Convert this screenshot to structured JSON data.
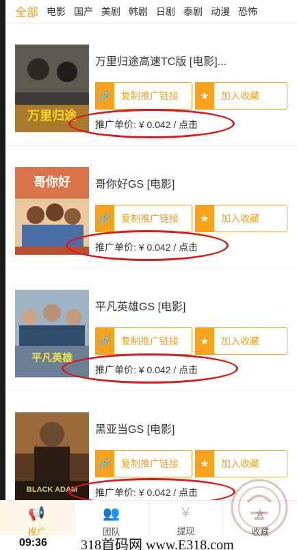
{
  "categories": [
    "全部",
    "电影",
    "国产",
    "美剧",
    "韩剧",
    "日剧",
    "泰剧",
    "动漫",
    "恐怖"
  ],
  "items": [
    {
      "title": "万里归途高速TC版 [电影]...",
      "copy_label": "复制推广链接",
      "fav_label": "加入收藏",
      "price": "推广单价: ¥ 0.042 / 点击",
      "poster_text": "万里归途",
      "poster_color": "#3b3a36"
    },
    {
      "title": "哥你好GS [电影]",
      "copy_label": "复制推广链接",
      "fav_label": "加入收藏",
      "price": "推广单价: ¥ 0.042 / 点击",
      "poster_text": "哥你好",
      "poster_color": "#b8502e"
    },
    {
      "title": "平凡英雄GS [电影]",
      "copy_label": "复制推广链接",
      "fav_label": "加入收藏",
      "price": "推广单价: ¥ 0.042 / 点击",
      "poster_text": "平凡英雄",
      "poster_color": "#6a7f95"
    },
    {
      "title": "黑亚当GS [电影]",
      "copy_label": "复制推广链接",
      "fav_label": "加入收藏",
      "price": "推广单价: ¥ 0.042 / 点击",
      "poster_text": "BLACK ADAM",
      "poster_color": "#5a3a22"
    }
  ],
  "tabs": [
    {
      "label": "推广",
      "icon": "megaphone-icon"
    },
    {
      "label": "团队",
      "icon": "team-icon"
    },
    {
      "label": "提现",
      "icon": "withdraw-icon"
    },
    {
      "label": "收藏",
      "icon": "favorites-icon"
    }
  ],
  "status_time": "09:36",
  "watermark": "318首码网 www.E318.com",
  "colors": {
    "accent": "#f7a21a",
    "annotation": "#d9191c"
  }
}
